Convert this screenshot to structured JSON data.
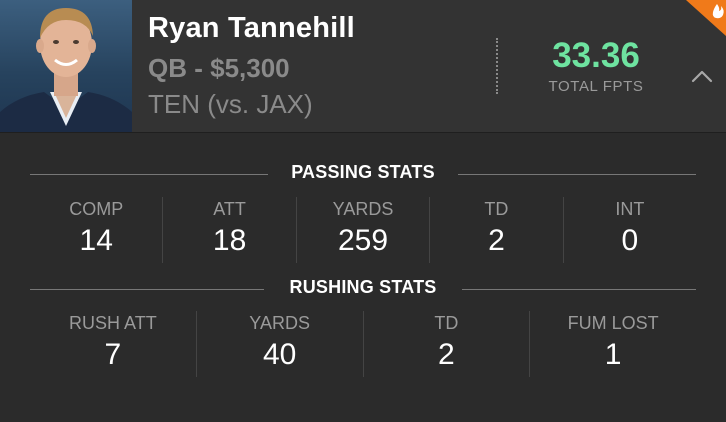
{
  "player": {
    "name": "Ryan Tannehill",
    "position_salary": "QB - $5,300",
    "matchup": "TEN (vs. JAX)"
  },
  "fpts": {
    "value": "33.36",
    "label": "TOTAL FPTS"
  },
  "colors": {
    "fpts_green": "#6ee3a0",
    "badge_orange": "#f07a1a"
  },
  "icons": {
    "collapse": "chevron-up-icon",
    "badge": "flame-icon"
  },
  "passing": {
    "title": "PASSING STATS",
    "stats": [
      {
        "label": "COMP",
        "value": "14"
      },
      {
        "label": "ATT",
        "value": "18"
      },
      {
        "label": "YARDS",
        "value": "259"
      },
      {
        "label": "TD",
        "value": "2"
      },
      {
        "label": "INT",
        "value": "0"
      }
    ]
  },
  "rushing": {
    "title": "RUSHING STATS",
    "stats": [
      {
        "label": "RUSH ATT",
        "value": "7"
      },
      {
        "label": "YARDS",
        "value": "40"
      },
      {
        "label": "TD",
        "value": "2"
      },
      {
        "label": "FUM LOST",
        "value": "1"
      }
    ]
  }
}
